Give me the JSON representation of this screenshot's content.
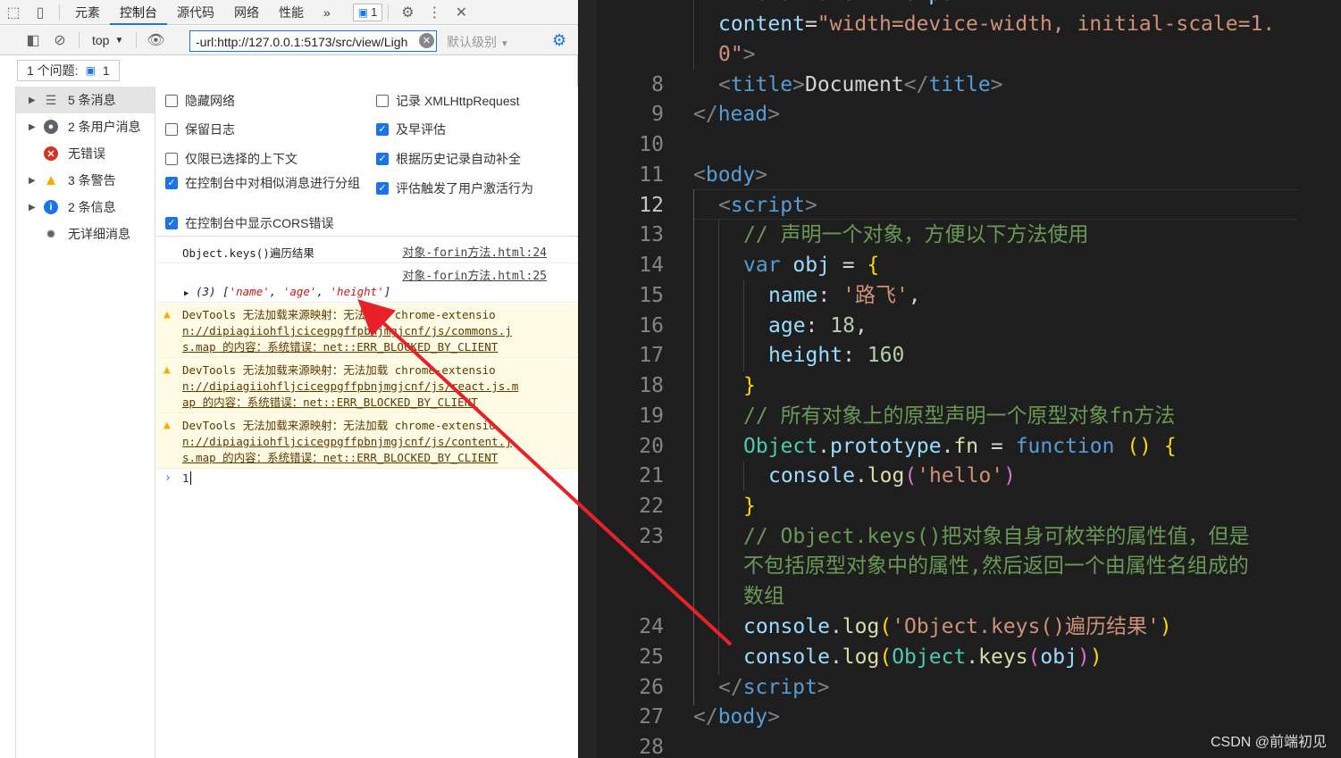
{
  "devtools": {
    "tabs": [
      "元素",
      "控制台",
      "源代码",
      "网络",
      "性能"
    ],
    "active_tab": "控制台",
    "more_tabs": "»",
    "issue_badge_count": "1",
    "context": "top",
    "filter_value": "-url:http://127.0.0.1:5173/src/view/Ligh",
    "levels": "默认级别",
    "issues_label": "1 个问题:",
    "issues_count": "1",
    "sidebar": [
      {
        "label": "5 条消息",
        "icon": "list-icon",
        "color": "#5f6368"
      },
      {
        "label": "2 条用户消息",
        "icon": "user-icon",
        "color": "#5f6368"
      },
      {
        "label": "无错误",
        "icon": "error-icon",
        "color": "#d93025"
      },
      {
        "label": "3 条警告",
        "icon": "warning-icon",
        "color": "#f9ab00"
      },
      {
        "label": "2 条信息",
        "icon": "info-icon",
        "color": "#1a73e8"
      },
      {
        "label": "无详细消息",
        "icon": "bug-icon",
        "color": "#5f6368"
      }
    ],
    "settings_left": [
      {
        "label": "隐藏网络",
        "checked": false
      },
      {
        "label": "保留日志",
        "checked": false
      },
      {
        "label": "仅限已选择的上下文",
        "checked": false
      },
      {
        "label": "在控制台中对相似消息进行分组",
        "checked": true
      },
      {
        "label": "在控制台中显示CORS错误",
        "checked": true
      }
    ],
    "settings_right": [
      {
        "label": "记录 XMLHttpRequest",
        "checked": false
      },
      {
        "label": "及早评估",
        "checked": true
      },
      {
        "label": "根据历史记录自动补全",
        "checked": true
      },
      {
        "label": "评估触发了用户激活行为",
        "checked": true
      }
    ],
    "console": {
      "log1_text": "Object.keys()遍历结果",
      "log1_source": "对象-forin方法.html:24",
      "log2_source": "对象-forin方法.html:25",
      "log2_count": "(3)",
      "log2_items": [
        "'name'",
        "'age'",
        "'height'"
      ],
      "warnings": [
        {
          "lines": [
            "DevTools 无法加载来源映射：无法加载 chrome-extensio",
            "n://dipiagiiohfljcicegpgffpbnjmgjcnf/js/commons.j",
            "s.map 的内容：系统错误：net::ERR_BLOCKED_BY_CLIENT"
          ]
        },
        {
          "lines": [
            "DevTools 无法加载来源映射：无法加载 chrome-extensio",
            "n://dipiagiiohfljcicegpgffpbnjmgjcnf/js/react.js.m",
            "ap 的内容：系统错误：net::ERR_BLOCKED_BY_CLIENT"
          ]
        },
        {
          "lines": [
            "DevTools 无法加载来源映射：无法加载 chrome-extensio",
            "n://dipiagiiohfljcicegpgffpbnjmgjcnf/js/content.j",
            "s.map 的内容：系统错误：net::ERR_BLOCKED_BY_CLIENT"
          ]
        }
      ],
      "prompt_value": "1"
    }
  },
  "editor": {
    "line_numbers": [
      "8",
      "9",
      "10",
      "11",
      "12",
      "13",
      "14",
      "15",
      "16",
      "17",
      "18",
      "19",
      "20",
      "21",
      "22",
      "23",
      "24",
      "25",
      "26",
      "27",
      "28"
    ],
    "current_line": "12",
    "watermark": "CSDN @前端初见",
    "colors": {
      "background": "#1e1e1e",
      "tag": "#569cd6",
      "string": "#ce9178",
      "comment": "#6a9955",
      "arrow": "#e8202a"
    }
  }
}
